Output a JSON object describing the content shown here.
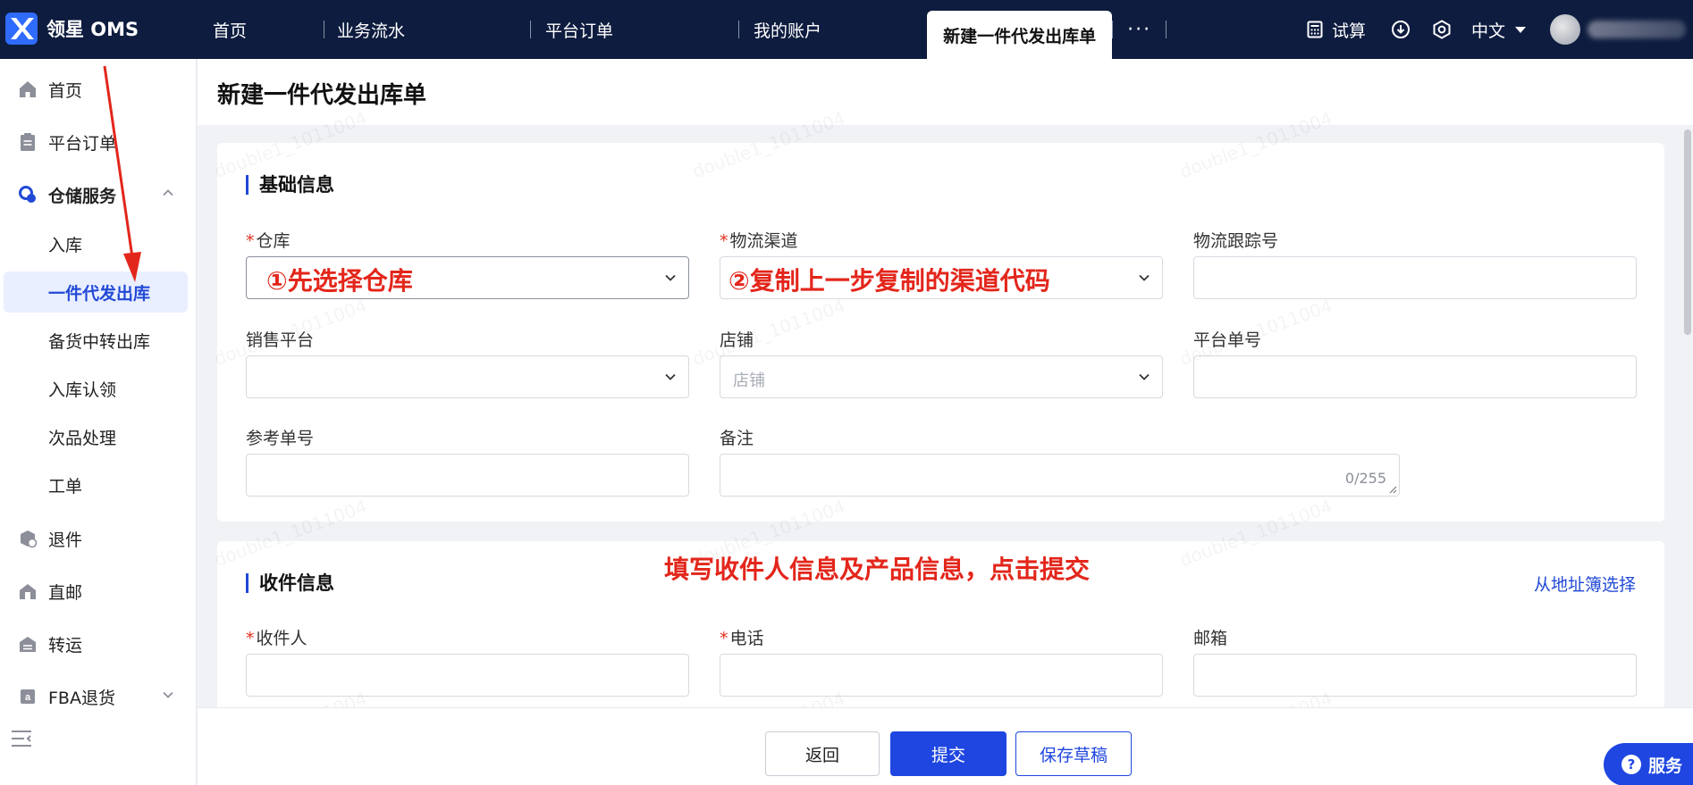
{
  "app": {
    "name": "领星 OMS"
  },
  "top_nav": {
    "items": [
      "首页",
      "业务流水",
      "平台订单",
      "我的账户"
    ],
    "active": "新建一件代发出库单",
    "more": "···",
    "trial": "试算",
    "language": "中文"
  },
  "sidebar": {
    "home": "首页",
    "platform_orders": "平台订单",
    "warehouse_services": "仓储服务",
    "sub_items": [
      "入库",
      "一件代发出库",
      "备货中转出库",
      "入库认领",
      "次品处理",
      "工单"
    ],
    "returns": "退件",
    "direct_mail": "直邮",
    "transfer": "转运",
    "fba_returns": "FBA退货"
  },
  "page": {
    "title": "新建一件代发出库单"
  },
  "basic_info": {
    "title": "基础信息",
    "warehouse_label": "仓库",
    "channel_label": "物流渠道",
    "tracking_label": "物流跟踪号",
    "sales_platform_label": "销售平台",
    "shop_label": "店铺",
    "shop_placeholder": "店铺",
    "platform_order_label": "平台单号",
    "reference_label": "参考单号",
    "remark_label": "备注",
    "remark_counter": "0/255"
  },
  "recipient_info": {
    "title": "收件信息",
    "address_book_link": "从地址簿选择",
    "recipient_label": "收件人",
    "phone_label": "电话",
    "email_label": "邮箱"
  },
  "annotations": {
    "step1": "①先选择仓库",
    "step2": "②复制上一步复制的渠道代码",
    "step3": "填写收件人信息及产品信息，点击提交"
  },
  "buttons": {
    "back": "返回",
    "submit": "提交",
    "save_draft": "保存草稿"
  },
  "service": {
    "label": "服务",
    "icon": "?"
  },
  "watermark": "double1_1011004",
  "colors": {
    "topbar": "#0e1c3f",
    "primary": "#1f46e0",
    "annotation": "#e3261b"
  }
}
